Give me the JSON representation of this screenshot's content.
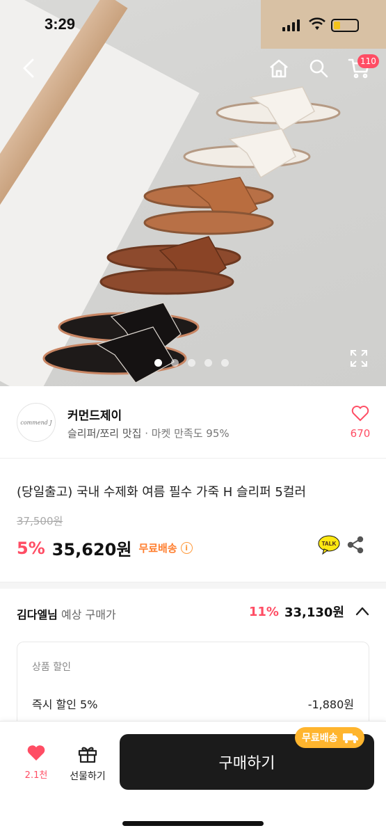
{
  "status": {
    "time": "3:29"
  },
  "nav": {
    "cart_count": "110"
  },
  "seller": {
    "avatar_text": "commend J",
    "name": "커먼드제이",
    "category": "슬리퍼/쪼리 맛집",
    "satisfaction": " · 마켓 만족도 95%",
    "likes": "670"
  },
  "product": {
    "title": "(당일출고) 국내 수제화 여름 필수 가죽 H 슬리퍼 5컬러",
    "original_price": "37,500원",
    "discount": "5%",
    "price": "35,620원",
    "shipping": "무료배송",
    "talk_label": "TALK"
  },
  "expected": {
    "user": "김다엘님",
    "label": " 예상 구매가",
    "discount": "11%",
    "price": "33,130원"
  },
  "breakdown": {
    "header": "상품 할인",
    "row_label": "즉시 할인 5%",
    "row_value": "-1,880원"
  },
  "bottom": {
    "like_count": "2.1천",
    "gift_label": "선물하기",
    "buy_label": "구매하기",
    "ship_badge": "무료배송"
  },
  "carousel": {
    "total": 5,
    "active_index": 0
  },
  "colors": {
    "accent": "#ff4d64",
    "shipping": "#ff7e2e",
    "buy_bg": "#1b1b1b"
  }
}
